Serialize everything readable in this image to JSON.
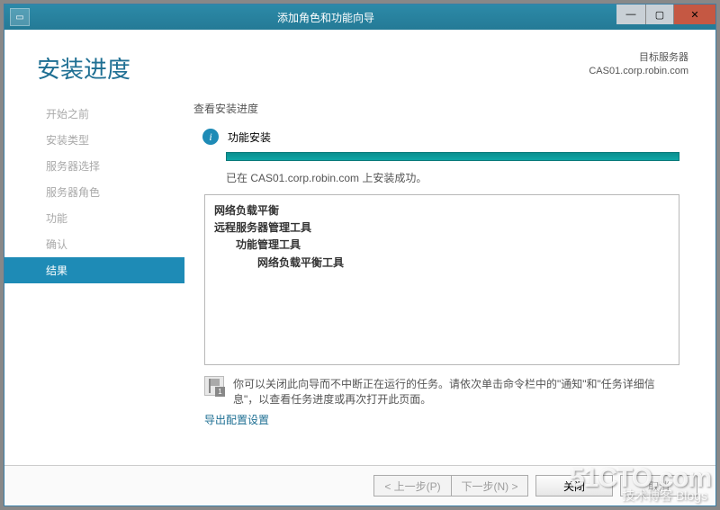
{
  "window": {
    "title": "添加角色和功能向导"
  },
  "header": {
    "page_title": "安装进度",
    "target_label": "目标服务器",
    "target_value": "CAS01.corp.robin.com"
  },
  "sidebar": {
    "steps": [
      {
        "label": "开始之前"
      },
      {
        "label": "安装类型"
      },
      {
        "label": "服务器选择"
      },
      {
        "label": "服务器角色"
      },
      {
        "label": "功能"
      },
      {
        "label": "确认"
      },
      {
        "label": "结果",
        "active": true
      }
    ]
  },
  "content": {
    "heading": "查看安装进度",
    "status": "功能安装",
    "success": "已在 CAS01.corp.robin.com 上安装成功。",
    "features": [
      "网络负载平衡",
      "远程服务器管理工具",
      "功能管理工具",
      "网络负载平衡工具"
    ],
    "note": "你可以关闭此向导而不中断正在运行的任务。请依次单击命令栏中的\"通知\"和\"任务详细信息\"，以查看任务进度或再次打开此页面。",
    "export_link": "导出配置设置"
  },
  "footer": {
    "prev": "< 上一步(P)",
    "next": "下一步(N) >",
    "close": "关闭",
    "cancel": "取消"
  },
  "watermark": {
    "main": "51CTO.com",
    "sub": "技术博客 Blogs"
  }
}
